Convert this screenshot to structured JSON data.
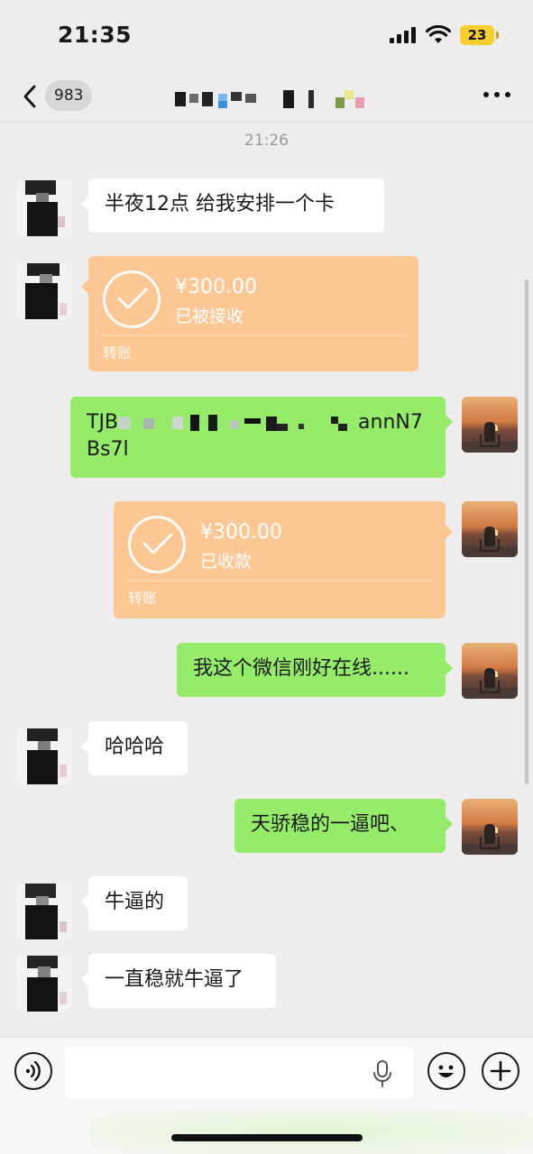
{
  "status_bar": {
    "time": "21:35",
    "battery": "23"
  },
  "nav": {
    "unread_count": "983"
  },
  "timestamp": "21:26",
  "messages": {
    "m1": "半夜12点 给我安排一个卡",
    "m2": {
      "amount": "¥300.00",
      "status": "已被接收",
      "label": "转账"
    },
    "m3": {
      "prefix": "TJB",
      "suffix": "annN7",
      "line2": "Bs7l"
    },
    "m4": {
      "amount": "¥300.00",
      "status": "已收款",
      "label": "转账"
    },
    "m5": "我这个微信刚好在线......",
    "m6": "哈哈哈",
    "m7": "天骄稳的一逼吧、",
    "m8": "牛逼的",
    "m9": "一直稳就牛逼了"
  },
  "colors": {
    "bubble_out": "#95ec69",
    "bubble_in": "#ffffff",
    "transfer": "#fdc794",
    "background": "#ededed"
  },
  "icons": [
    "back-icon",
    "more-icon",
    "check-icon",
    "voice-icon",
    "mic-icon",
    "emoji-icon",
    "plus-icon"
  ]
}
